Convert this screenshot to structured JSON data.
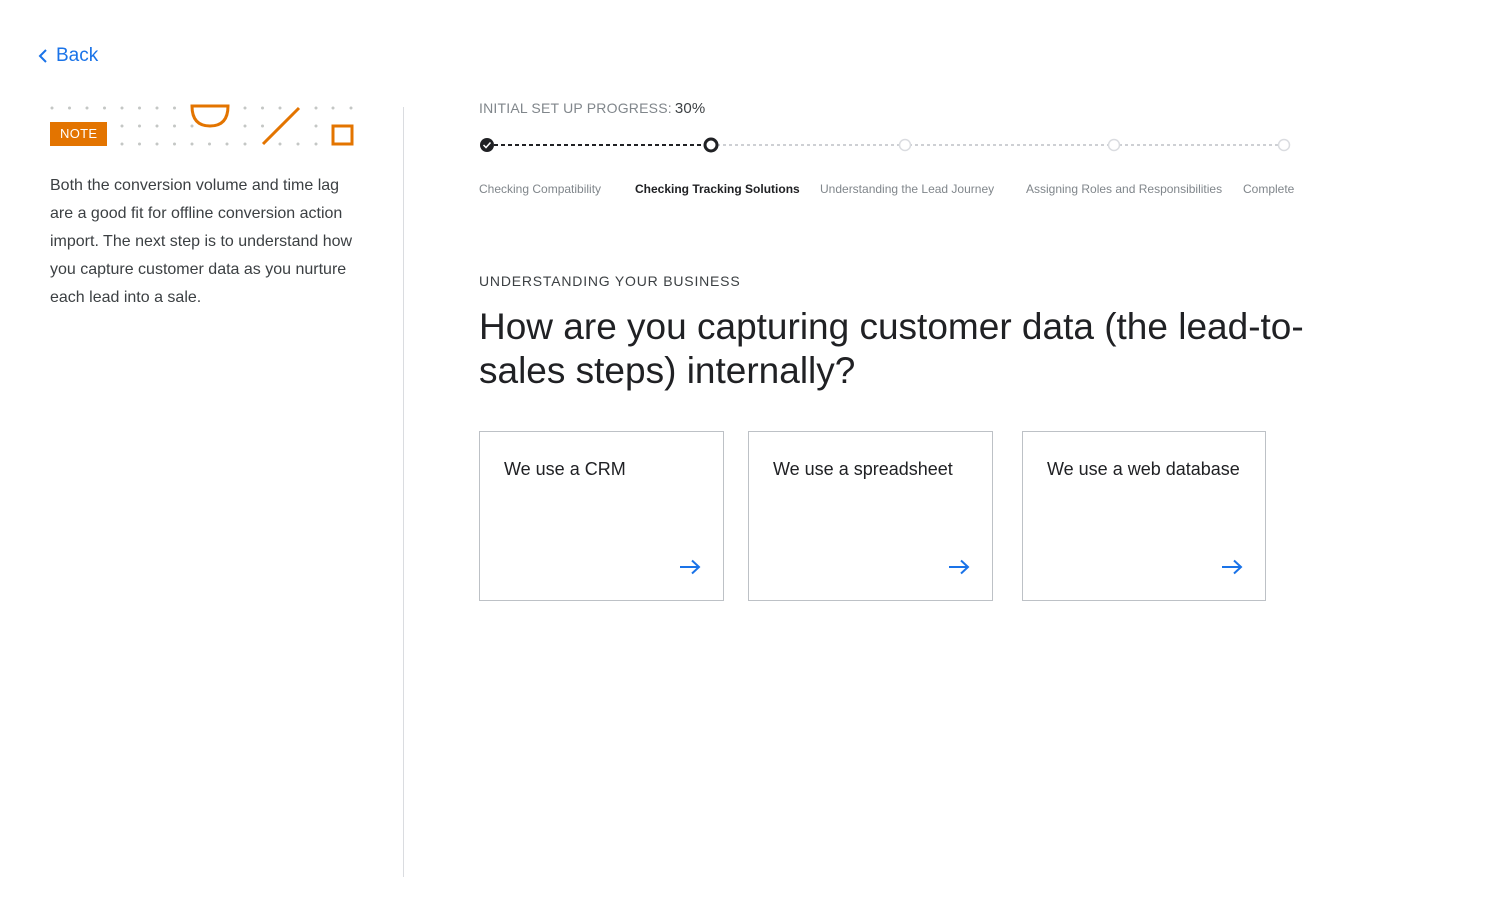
{
  "nav": {
    "back_label": "Back"
  },
  "note": {
    "badge": "NOTE",
    "text": "Both the conversion volume and time lag are a good fit for offline conversion action import. The next step is to understand how you capture customer data as you nurture each lead into a sale."
  },
  "progress": {
    "label": "INITIAL SET UP PROGRESS:",
    "percent_text": "30%",
    "percent_value": 30,
    "steps": [
      {
        "label": "Checking Compatibility",
        "state": "complete"
      },
      {
        "label": "Checking Tracking Solutions",
        "state": "current"
      },
      {
        "label": "Understanding the Lead Journey",
        "state": "upcoming"
      },
      {
        "label": "Assigning Roles and Responsibilities",
        "state": "upcoming"
      },
      {
        "label": "Complete",
        "state": "upcoming"
      }
    ]
  },
  "section": {
    "eyebrow": "UNDERSTANDING YOUR BUSINESS",
    "question": "How are you capturing customer data (the lead-to-sales steps) internally?"
  },
  "options": [
    {
      "label": "We use a CRM",
      "icon": "arrow-right-icon"
    },
    {
      "label": "We use a spreadsheet",
      "icon": "arrow-right-icon"
    },
    {
      "label": "We use a web database",
      "icon": "arrow-right-icon"
    }
  ],
  "colors": {
    "accent": "#1a73e8",
    "note_orange": "#e37400",
    "text_primary": "#202124",
    "muted": "#80868b",
    "border": "#bdc1c6"
  }
}
